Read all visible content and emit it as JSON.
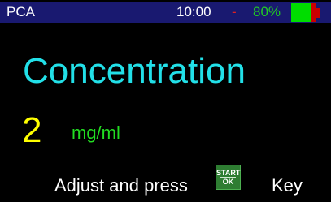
{
  "status": {
    "mode": "PCA",
    "time": "10:00",
    "separator": "-",
    "battery_text": "80%",
    "battery_level": 0.8
  },
  "setting": {
    "title": "Concentration",
    "value": "2",
    "unit": "mg/ml"
  },
  "prompt": {
    "before": "Adjust and press",
    "key_top": "START",
    "key_bottom": "OK",
    "after": "Key"
  },
  "colors": {
    "status_bar": "#191970",
    "title": "#22e0e8",
    "value": "#ffff00",
    "unit": "#22dd22",
    "key": "#2e7d32"
  },
  "icons": {
    "battery": "battery-icon",
    "key": "start-ok-key-icon"
  }
}
